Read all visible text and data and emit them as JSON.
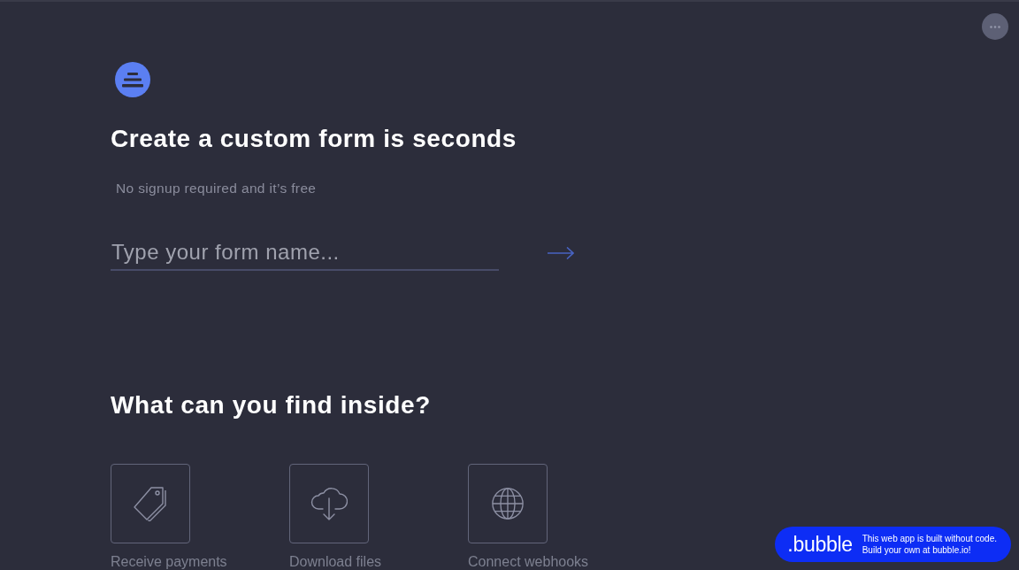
{
  "hero": {
    "title": "Create a custom form is seconds",
    "subtitle": "No signup required and it’s free",
    "form_name_field": {
      "placeholder": "Type your form name..."
    }
  },
  "features": {
    "title": "What can you find inside?",
    "items": [
      {
        "kind": "tag",
        "label": "Receive payments"
      },
      {
        "kind": "cloud-download",
        "label": "Download files"
      },
      {
        "kind": "globe",
        "label": "Connect webhooks"
      }
    ]
  },
  "bubble_badge": {
    "logo": ".bubble",
    "lines": [
      "This web app is built without code.",
      "Build your own at bubble.io!"
    ]
  }
}
